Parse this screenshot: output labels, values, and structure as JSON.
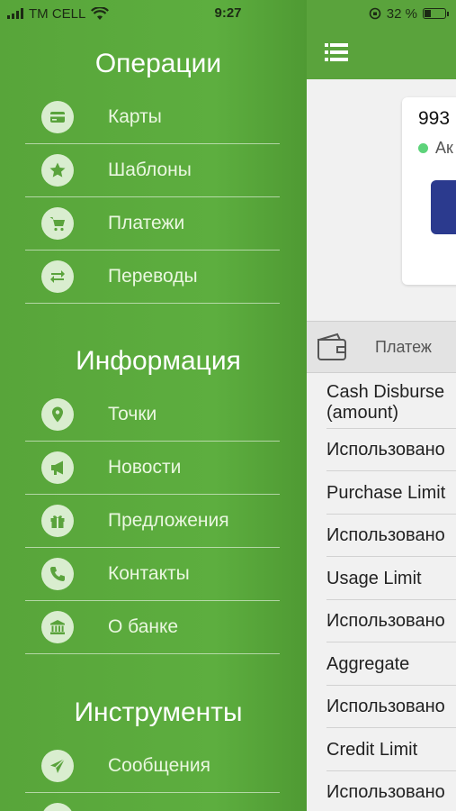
{
  "status_bar": {
    "carrier": "TM CELL",
    "time": "9:27",
    "battery_percent": "32 %",
    "battery_level": 0.32
  },
  "sidebar": {
    "sections": [
      {
        "title": "Операции",
        "items": [
          {
            "label": "Карты",
            "icon": "card-icon"
          },
          {
            "label": "Шаблоны",
            "icon": "star-icon"
          },
          {
            "label": "Платежи",
            "icon": "cart-icon"
          },
          {
            "label": "Переводы",
            "icon": "transfer-icon"
          }
        ]
      },
      {
        "title": "Информация",
        "items": [
          {
            "label": "Точки",
            "icon": "location-icon"
          },
          {
            "label": "Новости",
            "icon": "megaphone-icon"
          },
          {
            "label": "Предложения",
            "icon": "gift-icon"
          },
          {
            "label": "Контакты",
            "icon": "phone-icon"
          },
          {
            "label": "О банке",
            "icon": "bank-icon"
          }
        ]
      },
      {
        "title": "Инструменты",
        "items": [
          {
            "label": "Сообщения",
            "icon": "send-icon"
          }
        ]
      }
    ]
  },
  "main": {
    "card": {
      "number": "993",
      "status": "Ак",
      "status_color": "#5dd37a"
    },
    "tab": {
      "label": "Платеж"
    },
    "rows": [
      {
        "line1": "Cash Disburse",
        "line2": "(amount)"
      },
      {
        "line1": "Использовано"
      },
      {
        "line1": "Purchase Limit"
      },
      {
        "line1": "Использовано"
      },
      {
        "line1": "Usage Limit"
      },
      {
        "line1": "Использовано"
      },
      {
        "line1": "Aggregate"
      },
      {
        "line1": "Использовано"
      },
      {
        "line1": "Credit Limit"
      },
      {
        "line1": "Использовано"
      }
    ]
  },
  "colors": {
    "brand_green": "#5aa33c",
    "icon_circle": "#d9edcf"
  }
}
